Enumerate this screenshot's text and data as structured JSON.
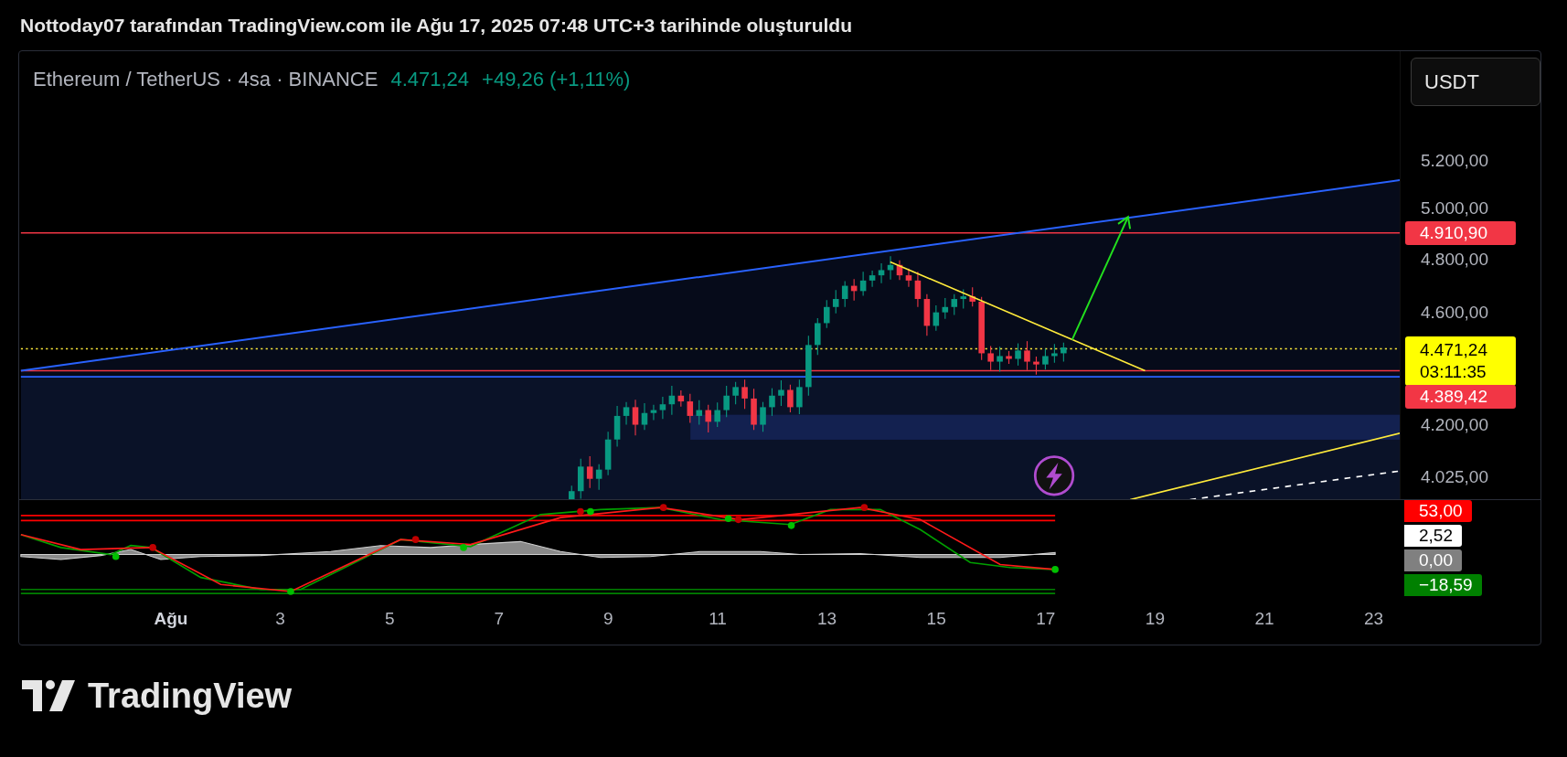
{
  "caption": "Nottoday07 tarafından TradingView.com ile Ağu 17, 2025 07:48 UTC+3 tarihinde oluşturuldu",
  "symbol": {
    "name": "Ethereum / TetherUS · 4sa · BINANCE",
    "price": "4.471,24",
    "change": "+49,26 (+1,11%)"
  },
  "currency_button": "USDT",
  "price_axis": [
    "5.200,00",
    "5.000,00",
    "4.800,00",
    "4.600,00",
    "4.200,00",
    "4.025,00"
  ],
  "price_labels": [
    {
      "kind": "line",
      "value": "4.910,90",
      "color": "#f23645"
    },
    {
      "kind": "last",
      "value": "4.471,24",
      "countdown": "03:11:35",
      "color": "#ffff00"
    },
    {
      "kind": "line",
      "value": "4.389,42",
      "color": "#f23645"
    }
  ],
  "indicator_labels": [
    {
      "value": "53,00",
      "color": "#ff0000"
    },
    {
      "value": "2,52",
      "color": "#ffffff"
    },
    {
      "value": "0,00",
      "color": "#808080"
    },
    {
      "value": "−18,59",
      "color": "#008000"
    }
  ],
  "time_axis": [
    {
      "label": "Ağu",
      "kind": "month"
    },
    {
      "label": "3",
      "kind": "day"
    },
    {
      "label": "5",
      "kind": "day"
    },
    {
      "label": "7",
      "kind": "day"
    },
    {
      "label": "9",
      "kind": "day"
    },
    {
      "label": "11",
      "kind": "day"
    },
    {
      "label": "13",
      "kind": "day"
    },
    {
      "label": "15",
      "kind": "day"
    },
    {
      "label": "17",
      "kind": "day"
    },
    {
      "label": "19",
      "kind": "day"
    },
    {
      "label": "21",
      "kind": "day"
    },
    {
      "label": "23",
      "kind": "day"
    }
  ],
  "footer": {
    "brand": "TradingView"
  }
}
